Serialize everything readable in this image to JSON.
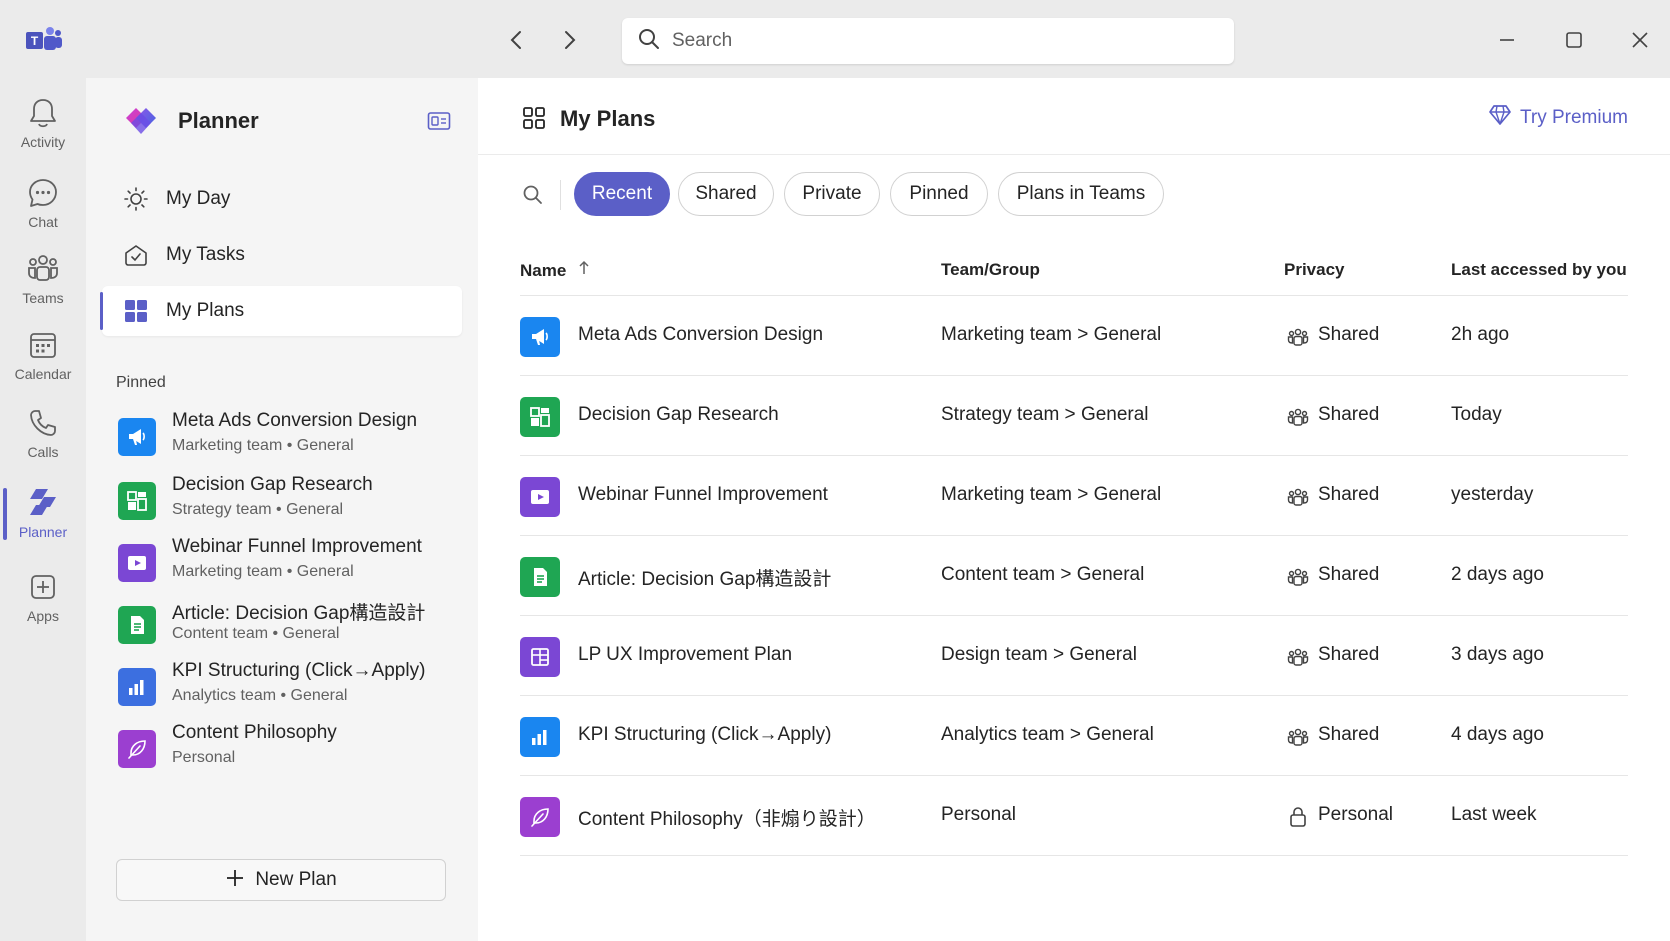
{
  "titlebar": {
    "search_placeholder": "Search",
    "icons": [
      "teams-logo",
      "back-arrow-icon",
      "forward-arrow-icon",
      "search-icon",
      "minimize-icon",
      "maximize-icon",
      "close-icon"
    ]
  },
  "rail": {
    "items": [
      {
        "label": "Activity",
        "icon": "bell-icon"
      },
      {
        "label": "Chat",
        "icon": "chat-icon"
      },
      {
        "label": "Teams",
        "icon": "teams-icon"
      },
      {
        "label": "Calendar",
        "icon": "calendar-icon"
      },
      {
        "label": "Calls",
        "icon": "phone-icon"
      },
      {
        "label": "Planner",
        "icon": "planner-icon",
        "active": true
      },
      {
        "label": "Apps",
        "icon": "add-apps-icon"
      }
    ]
  },
  "leftpane": {
    "title": "Planner",
    "nav": [
      {
        "label": "My Day",
        "icon": "sun-icon"
      },
      {
        "label": "My Tasks",
        "icon": "tasks-icon"
      },
      {
        "label": "My Plans",
        "icon": "grid-icon",
        "active": true
      }
    ],
    "pinned_title": "Pinned",
    "pinned": [
      {
        "name": "Meta Ads Conversion Design",
        "sub": "Marketing team • General",
        "color": "#1a86f0",
        "icon": "megaphone-icon"
      },
      {
        "name": "Decision Gap Research",
        "sub": "Strategy team • General",
        "color": "#1fa653",
        "icon": "layout-icon"
      },
      {
        "name": "Webinar Funnel Improvement",
        "sub": "Marketing team • General",
        "color": "#7b47d4",
        "icon": "video-icon"
      },
      {
        "name": "Article: Decision Gap構造設計",
        "sub": "Content team • General",
        "color": "#1fa653",
        "icon": "document-icon"
      },
      {
        "name": "KPI Structuring (Click→Apply)",
        "sub": "Analytics team • General",
        "color": "#3c6fe0",
        "icon": "bar-chart-icon"
      },
      {
        "name": "Content Philosophy",
        "sub": "Personal",
        "color": "#9b3fd0",
        "icon": "feather-icon"
      }
    ],
    "new_plan_label": "New Plan"
  },
  "main": {
    "title": "My Plans",
    "try_premium": "Try Premium",
    "filters": [
      {
        "label": "Recent",
        "active": true
      },
      {
        "label": "Shared"
      },
      {
        "label": "Private"
      },
      {
        "label": "Pinned"
      },
      {
        "label": "Plans in Teams"
      }
    ],
    "columns": {
      "name": "Name",
      "team": "Team/Group",
      "privacy": "Privacy",
      "accessed": "Last accessed by you"
    },
    "rows": [
      {
        "name": "Meta Ads Conversion Design",
        "team": "Marketing team",
        "channel": "General",
        "privacy": "Shared",
        "accessed": "2h ago",
        "color": "#1a86f0",
        "icon": "megaphone-icon"
      },
      {
        "name": "Decision Gap Research",
        "team": "Strategy team",
        "channel": "General",
        "privacy": "Shared",
        "accessed": "Today",
        "color": "#1fa653",
        "icon": "layout-icon"
      },
      {
        "name": "Webinar Funnel Improvement",
        "team": "Marketing team",
        "channel": "General",
        "privacy": "Shared",
        "accessed": "yesterday",
        "color": "#7b47d4",
        "icon": "video-icon"
      },
      {
        "name": "Article: Decision Gap構造設計",
        "team": "Content team",
        "channel": "General",
        "privacy": "Shared",
        "accessed": "2 days ago",
        "color": "#1fa653",
        "icon": "document-icon"
      },
      {
        "name": "LP UX Improvement Plan",
        "team": "Design team",
        "channel": "General",
        "privacy": "Shared",
        "accessed": "3 days ago",
        "color": "#7b47d4",
        "icon": "layout-grid-icon"
      },
      {
        "name": "KPI Structuring (Click→Apply)",
        "team": "Analytics team",
        "channel": "General",
        "privacy": "Shared",
        "accessed": "4 days ago",
        "color": "#1a86f0",
        "icon": "bar-chart-icon"
      },
      {
        "name": "Content Philosophy（非煽り設計）",
        "team": "Personal",
        "channel": "",
        "privacy": "Personal",
        "accessed": "Last week",
        "color": "#9b3fd0",
        "icon": "feather-icon"
      }
    ]
  },
  "colors": {
    "accent": "#5b5fc7",
    "rail_bg": "#ebebeb",
    "pane_bg": "#f5f5f5"
  }
}
